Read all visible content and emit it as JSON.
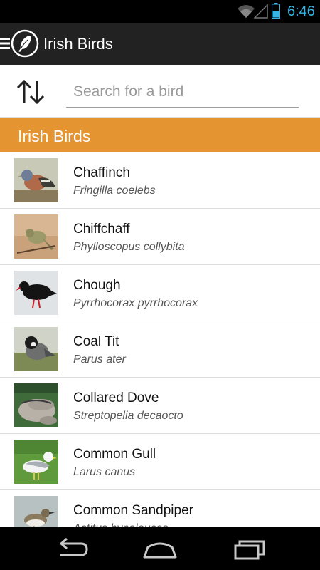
{
  "status_bar": {
    "time": "6:46",
    "accent_color": "#33b5e5"
  },
  "action_bar": {
    "title": "Irish Birds",
    "menu_icon": "hamburger-menu-icon",
    "logo_icon": "bird-feather-logo-icon"
  },
  "search": {
    "placeholder": "Search for a bird",
    "value": "",
    "sort_icon": "sort-up-down-arrows-icon"
  },
  "section": {
    "title": "Irish Birds",
    "color": "#e59432"
  },
  "birds": [
    {
      "common": "Chaffinch",
      "latin": "Fringilla coelebs"
    },
    {
      "common": "Chiffchaff",
      "latin": "Phylloscopus collybita"
    },
    {
      "common": "Chough",
      "latin": "Pyrrhocorax pyrrhocorax"
    },
    {
      "common": "Coal Tit",
      "latin": "Parus ater"
    },
    {
      "common": "Collared Dove",
      "latin": "Streptopelia decaocto"
    },
    {
      "common": "Common Gull",
      "latin": "Larus canus"
    },
    {
      "common": "Common Sandpiper",
      "latin": "Actitus hypoleucos"
    }
  ],
  "nav_bar": {
    "back_icon": "back-arrow-icon",
    "home_icon": "home-icon",
    "recents_icon": "recent-apps-icon"
  }
}
